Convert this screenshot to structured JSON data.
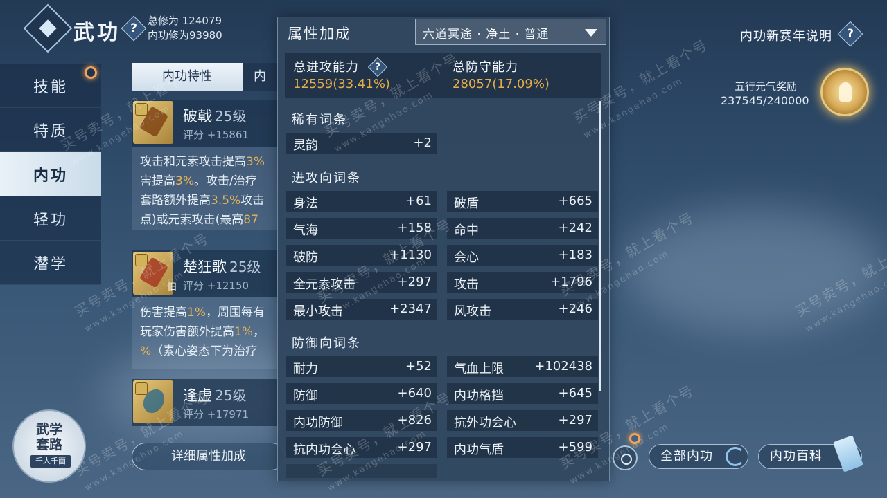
{
  "header": {
    "title": "武功",
    "help_glyph": "?",
    "total_cultivation": "总修为 124079",
    "inner_cultivation": "内功修为93980"
  },
  "nav": {
    "items": [
      {
        "label": "技能"
      },
      {
        "label": "特质"
      },
      {
        "label": "内功",
        "active": true
      },
      {
        "label": "轻功"
      },
      {
        "label": "潜学"
      }
    ]
  },
  "list": {
    "tabs": [
      "内功特性",
      "内"
    ],
    "cards": [
      {
        "name": "破戟",
        "level": "25级",
        "score": "评分 +15861",
        "body": [
          [
            "攻击和元素攻击提高",
            "3%",
            ""
          ],
          [
            "害提高",
            "3%",
            "。攻击/治疗"
          ],
          [
            "套路额外提高",
            "3.5%",
            "攻击"
          ],
          [
            "点)或元素攻击(最高",
            "87",
            ""
          ]
        ]
      },
      {
        "name": "楚狂歌",
        "level": "25级",
        "old_tag": "旧",
        "score": "评分 +12150",
        "body": [
          [
            "伤害提高",
            "1%",
            "，周围每有"
          ],
          [
            "玩家伤害额外提高",
            "1%",
            "，"
          ],
          [
            "",
            "%",
            "（素心姿态下为治疗"
          ]
        ]
      },
      {
        "name": "逢虚",
        "level": "25级",
        "score": "评分 +17971"
      }
    ],
    "detail_button": "详细属性加成"
  },
  "route_badge": {
    "line1": "武学",
    "line2": "套路",
    "sub": "千人千面"
  },
  "panel": {
    "title": "属性加成",
    "dropdown_value": "六道冥途 · 净土 · 普通",
    "attack_label": "总进攻能力",
    "attack_value": "12559(33.41%)",
    "defense_label": "总防守能力",
    "defense_value": "28057(17.09%)",
    "sections": {
      "rare": "稀有词条",
      "offense": "进攻向词条",
      "defense": "防御向词条"
    },
    "rare_stats": [
      {
        "name": "灵韵",
        "value": "+2"
      }
    ],
    "offense_stats": [
      {
        "name": "身法",
        "value": "+61"
      },
      {
        "name": "破盾",
        "value": "+665"
      },
      {
        "name": "气海",
        "value": "+158"
      },
      {
        "name": "命中",
        "value": "+242"
      },
      {
        "name": "破防",
        "value": "+1130"
      },
      {
        "name": "会心",
        "value": "+183"
      },
      {
        "name": "全元素攻击",
        "value": "+297"
      },
      {
        "name": "攻击",
        "value": "+1796"
      },
      {
        "name": "最小攻击",
        "value": "+2347"
      },
      {
        "name": "风攻击",
        "value": "+246"
      }
    ],
    "defense_stats": [
      {
        "name": "耐力",
        "value": "+52"
      },
      {
        "name": "气血上限",
        "value": "+102438"
      },
      {
        "name": "防御",
        "value": "+640"
      },
      {
        "name": "内功格挡",
        "value": "+645"
      },
      {
        "name": "内功防御",
        "value": "+826"
      },
      {
        "name": "抗外功会心",
        "value": "+297"
      },
      {
        "name": "抗内功会心",
        "value": "+297"
      },
      {
        "name": "内功气盾",
        "value": "+599"
      }
    ]
  },
  "right": {
    "season_link": "内功新赛年说明",
    "reward_label": "五行元气奖励",
    "reward_progress": "237545/240000",
    "all_inner_button": "全部内功",
    "wiki_button": "内功百科"
  },
  "watermark": {
    "text": "买号卖号，就上看个号",
    "url": "www.kangehao.com"
  },
  "colors": {
    "accent_gold": "#e6ac4a",
    "highlight": "#e5b45a",
    "panel_bg": "#324860"
  }
}
